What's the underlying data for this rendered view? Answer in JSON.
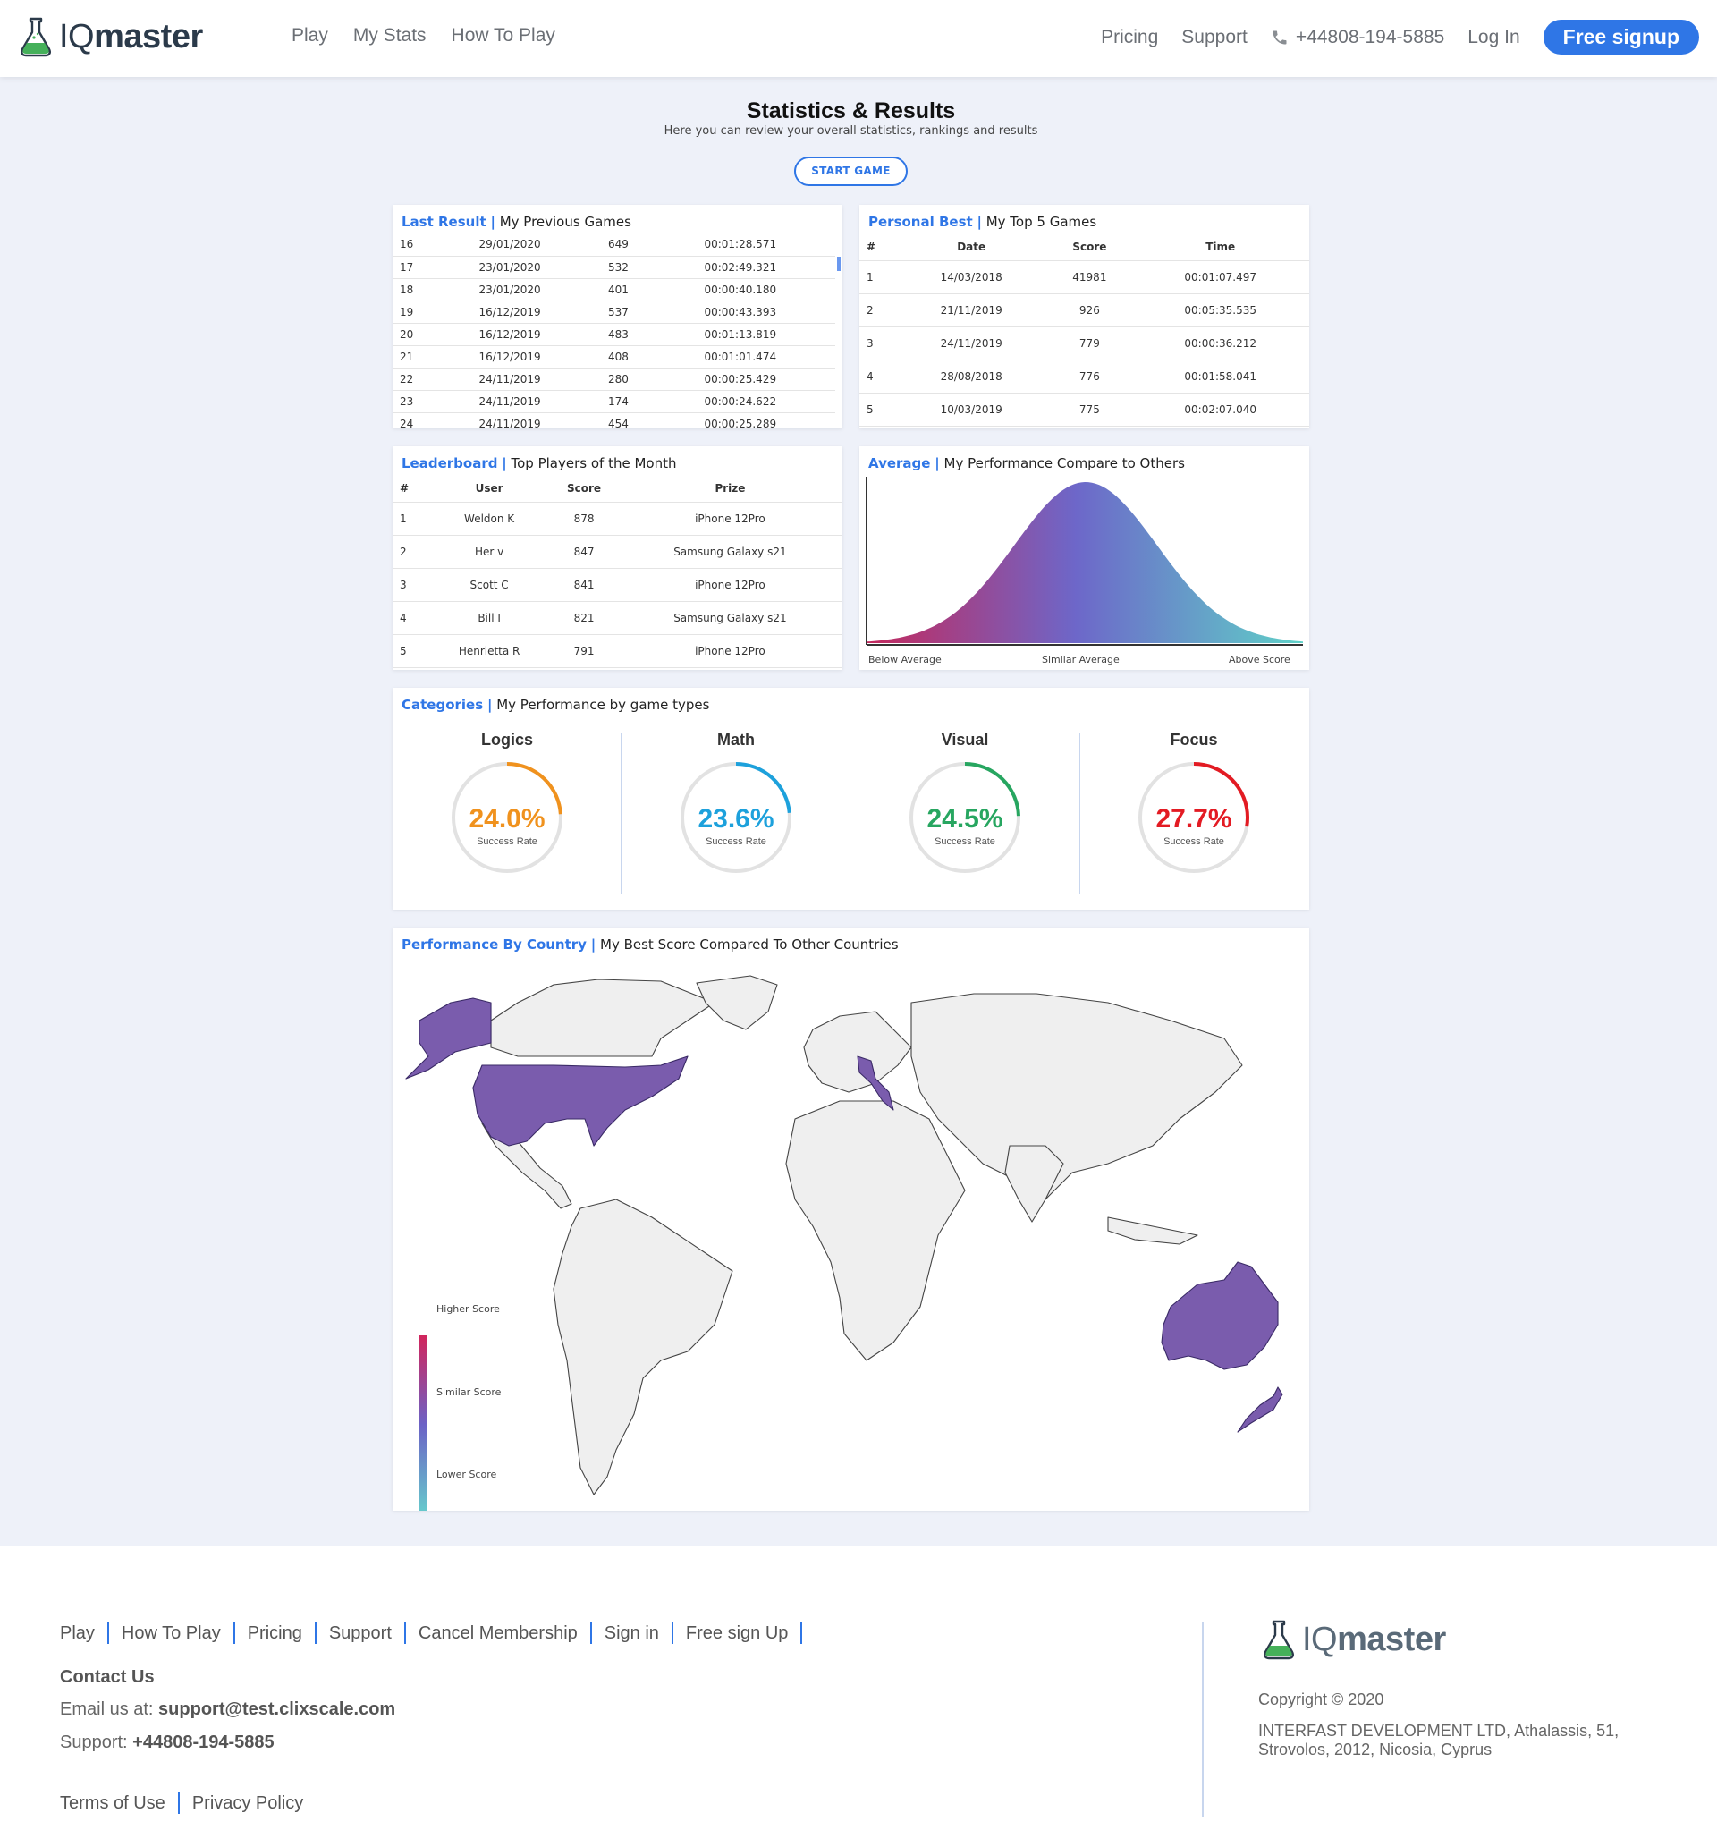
{
  "header": {
    "brand_iq": "IQ",
    "brand_master": "master",
    "nav_left": [
      "Play",
      "My Stats",
      "How To Play"
    ],
    "nav_right": {
      "pricing": "Pricing",
      "support": "Support",
      "phone": "+44808-194-5885",
      "login": "Log In",
      "signup": "Free signup"
    }
  },
  "page": {
    "title": "Statistics & Results",
    "subtitle": "Here you can review your overall statistics, rankings and results",
    "start_button": "START GAME"
  },
  "last_result": {
    "title_hl": "Last Result",
    "title_rest": "My Previous Games",
    "rows": [
      [
        "16",
        "29/01/2020",
        "649",
        "00:01:28.571"
      ],
      [
        "17",
        "23/01/2020",
        "532",
        "00:02:49.321"
      ],
      [
        "18",
        "23/01/2020",
        "401",
        "00:00:40.180"
      ],
      [
        "19",
        "16/12/2019",
        "537",
        "00:00:43.393"
      ],
      [
        "20",
        "16/12/2019",
        "483",
        "00:01:13.819"
      ],
      [
        "21",
        "16/12/2019",
        "408",
        "00:01:01.474"
      ],
      [
        "22",
        "24/11/2019",
        "280",
        "00:00:25.429"
      ],
      [
        "23",
        "24/11/2019",
        "174",
        "00:00:24.622"
      ],
      [
        "24",
        "24/11/2019",
        "454",
        "00:00:25.289"
      ]
    ]
  },
  "personal_best": {
    "title_hl": "Personal Best",
    "title_rest": "My Top 5 Games",
    "headers": [
      "#",
      "Date",
      "Score",
      "Time"
    ],
    "rows": [
      [
        "1",
        "14/03/2018",
        "41981",
        "00:01:07.497"
      ],
      [
        "2",
        "21/11/2019",
        "926",
        "00:05:35.535"
      ],
      [
        "3",
        "24/11/2019",
        "779",
        "00:00:36.212"
      ],
      [
        "4",
        "28/08/2018",
        "776",
        "00:01:58.041"
      ],
      [
        "5",
        "10/03/2019",
        "775",
        "00:02:07.040"
      ]
    ]
  },
  "leaderboard": {
    "title_hl": "Leaderboard",
    "title_rest": "Top Players of the Month",
    "headers": [
      "#",
      "User",
      "Score",
      "Prize"
    ],
    "rows": [
      [
        "1",
        "Weldon K",
        "878",
        "iPhone 12Pro"
      ],
      [
        "2",
        "Her v",
        "847",
        "Samsung Galaxy s21"
      ],
      [
        "3",
        "Scott C",
        "841",
        "iPhone 12Pro"
      ],
      [
        "4",
        "Bill I",
        "821",
        "Samsung Galaxy s21"
      ],
      [
        "5",
        "Henrietta R",
        "791",
        "iPhone 12Pro"
      ]
    ]
  },
  "average": {
    "title_hl": "Average",
    "title_rest": "My Performance Compare to Others",
    "labels": [
      "Below Average",
      "Similar Average",
      "Above Score"
    ],
    "colors": [
      "#c4285c",
      "#6d67c9",
      "#5fd1c8"
    ]
  },
  "categories": {
    "title_hl": "Categories",
    "title_rest": "My Performance by game types",
    "items": [
      {
        "name": "Logics",
        "pct": "24.0%",
        "value": 24.0,
        "label": "Success Rate",
        "color": "#f0921e"
      },
      {
        "name": "Math",
        "pct": "23.6%",
        "value": 23.6,
        "label": "Success Rate",
        "color": "#1da1dc"
      },
      {
        "name": "Visual",
        "pct": "24.5%",
        "value": 24.5,
        "label": "Success Rate",
        "color": "#27a660"
      },
      {
        "name": "Focus",
        "pct": "27.7%",
        "value": 27.7,
        "label": "Success Rate",
        "color": "#e31b23"
      }
    ]
  },
  "map": {
    "title_hl": "Performance By Country",
    "title_rest": "My Best Score Compared To Other Countries",
    "legend": [
      "Higher Score",
      "Similar Score",
      "Lower Score"
    ],
    "highlight_color": "#7a5cad"
  },
  "footer": {
    "links": [
      "Play",
      "How To Play",
      "Pricing",
      "Support",
      "Cancel Membership",
      "Sign in",
      "Free sign Up"
    ],
    "contact_title": "Contact Us",
    "email_prefix": "Email us at:",
    "email": "support@test.clixscale.com",
    "support_prefix": "Support:",
    "support_phone": "+44808-194-5885",
    "terms": "Terms of Use",
    "privacy": "Privacy Policy",
    "copyright": "Copyright © 2020",
    "address_1": "INTERFAST DEVELOPMENT LTD, Athalassis, 51,",
    "address_2": "Strovolos, 2012, Nicosia, Cyprus"
  }
}
